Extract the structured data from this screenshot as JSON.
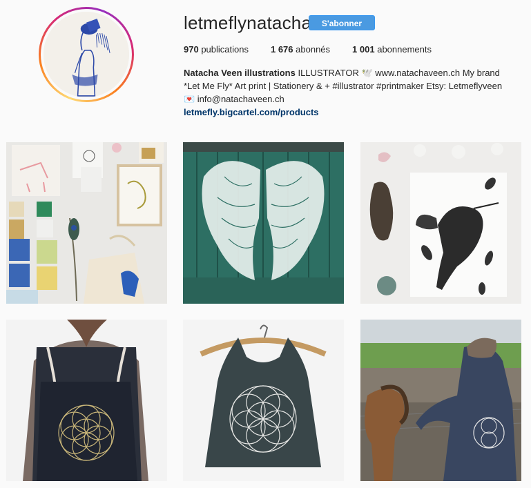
{
  "profile": {
    "username": "letmeflynatacha",
    "follow_label": "S'abonner",
    "stats": {
      "posts_count": "970",
      "posts_label": "publications",
      "followers_count": "1 676",
      "followers_label": "abonnés",
      "following_count": "1 001",
      "following_label": "abonnements"
    },
    "bio": {
      "full_name": "Natacha Veen illustrations",
      "line1_rest": " ILLUSTRATOR 🕊️ www.natachaveen.ch My brand",
      "line2": "*Let Me Fly* Art print | Stationery & + #illustrator #printmaker Etsy: Letmeflyveen",
      "line3": "💌 info@natachaveen.ch",
      "link": "letmefly.bigcartel.com/products"
    }
  },
  "colors": {
    "follow_button": "#4a9ae1",
    "link": "#003569",
    "background": "#fafafa"
  },
  "posts": [
    {
      "subject": "flat-lay-prints-tote-bag"
    },
    {
      "subject": "wings-mural-green-door"
    },
    {
      "subject": "hummingbird-illustration-card"
    },
    {
      "subject": "flower-of-life-backpack"
    },
    {
      "subject": "flower-of-life-tank-top"
    },
    {
      "subject": "horse-hoodie-field"
    }
  ]
}
